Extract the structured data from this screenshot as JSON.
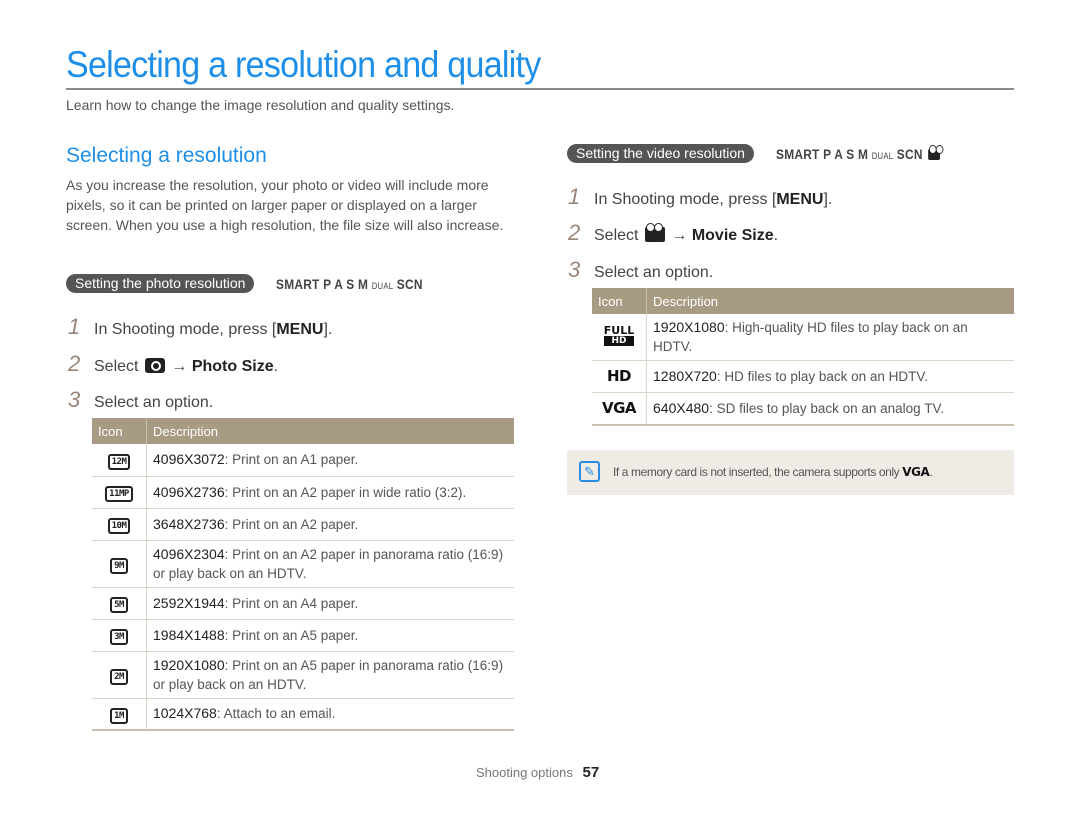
{
  "page": {
    "title": "Selecting a resolution and quality",
    "intro": "Learn how to change the image resolution and quality settings.",
    "accent_color": "#1e8fe8"
  },
  "left": {
    "heading": "Selecting a resolution",
    "paragraph": "As you increase the resolution, your photo or video will include more pixels, so it can be printed on larger paper or displayed on a larger screen. When you use a high resolution, the file size will also increase.",
    "section_pill": "Setting the photo resolution",
    "modes": [
      "SMART",
      "P",
      "A",
      "S",
      "M",
      "DUAL",
      "SCN"
    ],
    "steps": [
      {
        "num": "1",
        "pre": "In Shooting mode, press [",
        "bold": "MENU",
        "post": "]."
      },
      {
        "num": "2",
        "pre": "Select",
        "icon": "camera-icon",
        "arrow": "→",
        "bold": "Photo Size",
        "post": "."
      },
      {
        "num": "3",
        "pre": "Select an option."
      }
    ],
    "table": {
      "headers": [
        "Icon",
        "Description"
      ],
      "rows": [
        {
          "icon": "12M",
          "res": "4096X3072",
          "desc": ": Print on an A1 paper."
        },
        {
          "icon": "11MP",
          "res": "4096X2736",
          "desc": ": Print on an A2 paper in wide ratio (3:2)."
        },
        {
          "icon": "10M",
          "res": "3648X2736",
          "desc": ": Print on an A2 paper."
        },
        {
          "icon": "9M",
          "res": "4096X2304",
          "desc": ": Print on an A2 paper in panorama ratio (16:9) or play back on an HDTV."
        },
        {
          "icon": "5M",
          "res": "2592X1944",
          "desc": ": Print on an A4 paper."
        },
        {
          "icon": "3M",
          "res": "1984X1488",
          "desc": ": Print on an A5 paper."
        },
        {
          "icon": "2M",
          "res": "1920X1080",
          "desc": ": Print on an A5 paper in panorama ratio (16:9) or play back on an HDTV."
        },
        {
          "icon": "1M",
          "res": "1024X768",
          "desc": ": Attach to an email."
        }
      ]
    }
  },
  "right": {
    "section_pill": "Setting the video resolution",
    "modes": [
      "SMART",
      "P",
      "A",
      "S",
      "M",
      "DUAL",
      "SCN"
    ],
    "steps": [
      {
        "num": "1",
        "pre": "In Shooting mode, press [",
        "bold": "MENU",
        "post": "]."
      },
      {
        "num": "2",
        "pre": "Select",
        "icon": "movie-camera-icon",
        "arrow": "→",
        "bold": "Movie Size",
        "post": "."
      },
      {
        "num": "3",
        "pre": "Select an option."
      }
    ],
    "table": {
      "headers": [
        "Icon",
        "Description"
      ],
      "rows": [
        {
          "icon_top": "FULL",
          "icon_bottom": "HD",
          "res": "1920X1080",
          "desc": ": High-quality HD files to play back on an HDTV."
        },
        {
          "icon": "HD",
          "res": "1280X720",
          "desc": ": HD files to play back on an HDTV."
        },
        {
          "icon": "VGA",
          "res": "640X480",
          "desc": ": SD files to play back on an analog TV."
        }
      ]
    },
    "note": {
      "text": "If a memory card is not inserted, the camera supports only",
      "icon_label": "VGA",
      "end": "."
    }
  },
  "footer": {
    "section": "Shooting options",
    "page_number": "57"
  }
}
